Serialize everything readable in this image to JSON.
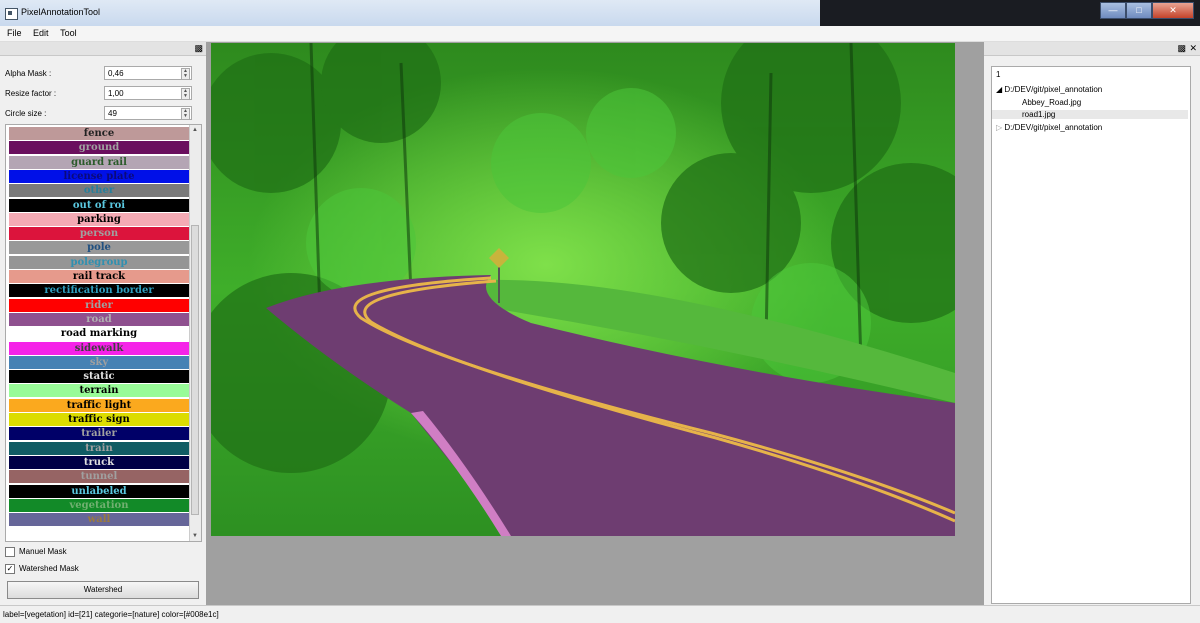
{
  "window": {
    "title": "PixelAnnotationTool"
  },
  "menu": [
    "File",
    "Edit",
    "Tool"
  ],
  "params": {
    "alpha_label": "Alpha Mask :",
    "alpha_value": "0,46",
    "resize_label": "Resize factor :",
    "resize_value": "1,00",
    "circle_label": "Circle size :",
    "circle_value": "49"
  },
  "labels": [
    {
      "name": "fence",
      "bg": "#be9999",
      "fg": "#222222"
    },
    {
      "name": "ground",
      "bg": "#6a0f5e",
      "fg": "#a0a0a0"
    },
    {
      "name": "guard rail",
      "bg": "#b4a5b4",
      "fg": "#2a5a2a"
    },
    {
      "name": "license plate",
      "bg": "#0010e8",
      "fg": "#0a0a7a"
    },
    {
      "name": "other",
      "bg": "#7a7a7a",
      "fg": "#2a7f9a"
    },
    {
      "name": "out of roi",
      "bg": "#000000",
      "fg": "#5ac8e0"
    },
    {
      "name": "parking",
      "bg": "#f4aab4",
      "fg": "#000000"
    },
    {
      "name": "person",
      "bg": "#dc143c",
      "fg": "#a0a0a0"
    },
    {
      "name": "pole",
      "bg": "#999999",
      "fg": "#205080"
    },
    {
      "name": "polegroup",
      "bg": "#959595",
      "fg": "#3090b0"
    },
    {
      "name": "rail track",
      "bg": "#e69a8c",
      "fg": "#000000"
    },
    {
      "name": "rectification border",
      "bg": "#000000",
      "fg": "#30a0c0"
    },
    {
      "name": "rider",
      "bg": "#ff0000",
      "fg": "#a0a0a0"
    },
    {
      "name": "road",
      "bg": "#8f508f",
      "fg": "#b0b0b0"
    },
    {
      "name": "road marking",
      "bg": "#ffffff",
      "fg": "#000000"
    },
    {
      "name": "sidewalk",
      "bg": "#f523e8",
      "fg": "#404040"
    },
    {
      "name": "sky",
      "bg": "#4682b4",
      "fg": "#a0a0a0"
    },
    {
      "name": "static",
      "bg": "#000000",
      "fg": "#e0e0e0"
    },
    {
      "name": "terrain",
      "bg": "#98fb98",
      "fg": "#000000"
    },
    {
      "name": "traffic light",
      "bg": "#fba91e",
      "fg": "#000000"
    },
    {
      "name": "traffic sign",
      "bg": "#dcdc00",
      "fg": "#000000"
    },
    {
      "name": "trailer",
      "bg": "#000068",
      "fg": "#a0a0a0"
    },
    {
      "name": "train",
      "bg": "#105c64",
      "fg": "#a0a0a0"
    },
    {
      "name": "truck",
      "bg": "#000046",
      "fg": "#e0e0e0"
    },
    {
      "name": "tunnel",
      "bg": "#966464",
      "fg": "#a0a0a0"
    },
    {
      "name": "unlabeled",
      "bg": "#000000",
      "fg": "#5ac8e0"
    },
    {
      "name": "vegetation",
      "bg": "#128a28",
      "fg": "#70b070"
    },
    {
      "name": "wall",
      "bg": "#666699",
      "fg": "#9a7a40"
    }
  ],
  "options": {
    "manual_mask": "Manuel Mask",
    "manual_checked": false,
    "watershed_mask": "Watershed Mask",
    "watershed_checked": true,
    "watershed_button": "Watershed"
  },
  "files": {
    "filter": "1",
    "tree": [
      {
        "text": "D:/DEV/git/pixel_annotation",
        "level": 0,
        "expanded": true
      },
      {
        "text": "Abbey_Road.jpg",
        "level": 1
      },
      {
        "text": "road1.jpg",
        "level": 1,
        "selected": true
      },
      {
        "text": "D:/DEV/git/pixel_annotation",
        "level": 0,
        "expanded": false
      }
    ]
  },
  "status": "label=[vegetation] id=[21] categorie=[nature] color=[#008e1c]",
  "icons": [
    "app-icon",
    "float-icon",
    "close-icon",
    "minimize-icon",
    "maximize-icon",
    "spin-arrow-icon",
    "expand-arrow-icon",
    "collapse-arrow-icon",
    "cursor-icon"
  ]
}
